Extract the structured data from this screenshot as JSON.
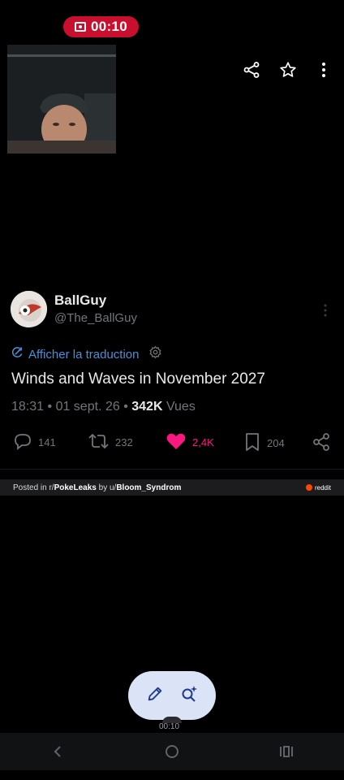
{
  "recording": {
    "time": "00:10",
    "icon": "screen-record-icon"
  },
  "camera_preview": {
    "icon": "person-video-preview"
  },
  "top_actions": {
    "share_icon": "share-icon",
    "star_icon": "star-icon",
    "more_icon": "more-vert-icon"
  },
  "post": {
    "author_name": "BallGuy",
    "author_handle": "@The_BallGuy",
    "translate_label": "Afficher la traduction",
    "text": "Winds and Waves in November 2027",
    "time": "18:31",
    "date": "01 sept. 26",
    "views_count": "342K",
    "views_label": "Vues",
    "separator": "•"
  },
  "actions": {
    "replies": "141",
    "reposts": "232",
    "likes": "2,4K",
    "bookmarks": "204"
  },
  "reddit_attribution": {
    "prefix": "Posted in r/",
    "subreddit": "PokeLeaks",
    "by": " by u/",
    "user": "Bloom_Syndrom",
    "brand": "reddit"
  },
  "fab": {
    "edit_icon": "pencil-icon",
    "search_icon": "sparkle-search-icon"
  },
  "bottom_time": "00:10",
  "colors": {
    "accent_like": "#f91880",
    "link": "#4a90d9",
    "record": "#c8102e",
    "fab_bg": "#dbe4f7"
  }
}
